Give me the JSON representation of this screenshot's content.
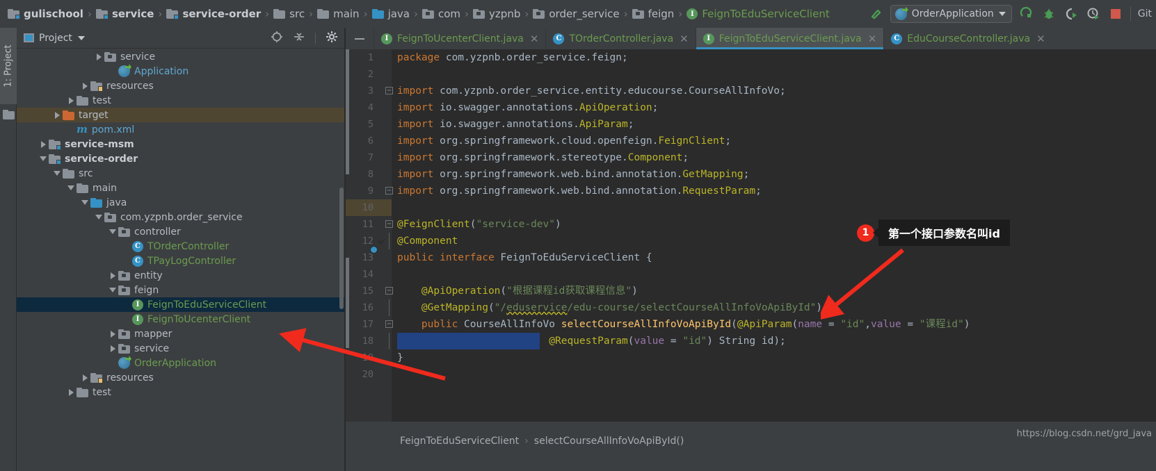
{
  "window": {
    "watermark": "https://blog.csdn.net/grd_java"
  },
  "breadcrumb": {
    "items": [
      {
        "label": "gulischool",
        "icon": "module-folder-icon",
        "style": "bold"
      },
      {
        "label": "service",
        "icon": "module-folder-icon",
        "style": "bold"
      },
      {
        "label": "service-order",
        "icon": "module-folder-icon",
        "style": "bold"
      },
      {
        "label": "src",
        "icon": "folder-icon",
        "style": "plain"
      },
      {
        "label": "main",
        "icon": "folder-icon",
        "style": "plain"
      },
      {
        "label": "java",
        "icon": "source-folder-icon",
        "style": "plain"
      },
      {
        "label": "com",
        "icon": "package-folder-icon",
        "style": "plain"
      },
      {
        "label": "yzpnb",
        "icon": "package-folder-icon",
        "style": "plain"
      },
      {
        "label": "order_service",
        "icon": "package-folder-icon",
        "style": "plain"
      },
      {
        "label": "feign",
        "icon": "package-folder-icon",
        "style": "plain"
      },
      {
        "label": "FeignToEduServiceClient",
        "icon": "interface-icon",
        "style": "interface"
      }
    ],
    "separator": "›"
  },
  "toolbar": {
    "run_config_name": "OrderApplication",
    "run_config_icon": "spring-boot-icon",
    "build_icon": "build-hammer-icon",
    "actions": [
      {
        "name": "run-icon",
        "glyph": "run"
      },
      {
        "name": "debug-icon",
        "glyph": "debug"
      },
      {
        "name": "run-with-coverage-icon",
        "glyph": "coverage"
      },
      {
        "name": "profile-icon",
        "glyph": "profile"
      },
      {
        "name": "stop-icon",
        "glyph": "stop"
      }
    ],
    "git_label": "Git"
  },
  "left_rail": {
    "tab_label": "1: Project"
  },
  "project_panel": {
    "title": "Project",
    "header_actions": [
      "locate-icon",
      "collapse-all-icon",
      "settings-gear-icon"
    ],
    "tree": [
      {
        "label": "service",
        "indent": 5,
        "twisty": "right",
        "icon": "package-folder-icon",
        "style": "plain"
      },
      {
        "label": "Application",
        "indent": 6,
        "twisty": "none",
        "icon": "spring-class-icon",
        "style": "blue"
      },
      {
        "label": "resources",
        "indent": 4,
        "twisty": "right",
        "icon": "resources-folder-icon",
        "style": "plain"
      },
      {
        "label": "test",
        "indent": 3,
        "twisty": "right",
        "icon": "folder-icon",
        "style": "plain"
      },
      {
        "label": "target",
        "indent": 2,
        "twisty": "right",
        "icon": "target-folder-icon",
        "style": "plain",
        "highlight": "target"
      },
      {
        "label": "pom.xml",
        "indent": 3,
        "twisty": "none",
        "icon": "maven-icon",
        "style": "blue"
      },
      {
        "label": "service-msm",
        "indent": 1,
        "twisty": "right",
        "icon": "module-folder-icon",
        "style": "bold"
      },
      {
        "label": "service-order",
        "indent": 1,
        "twisty": "down",
        "icon": "module-folder-icon",
        "style": "bold"
      },
      {
        "label": "src",
        "indent": 2,
        "twisty": "down",
        "icon": "folder-icon",
        "style": "plain"
      },
      {
        "label": "main",
        "indent": 3,
        "twisty": "down",
        "icon": "folder-icon",
        "style": "plain"
      },
      {
        "label": "java",
        "indent": 4,
        "twisty": "down",
        "icon": "source-folder-icon",
        "style": "plain"
      },
      {
        "label": "com.yzpnb.order_service",
        "indent": 5,
        "twisty": "down",
        "icon": "package-folder-icon",
        "style": "plain"
      },
      {
        "label": "controller",
        "indent": 6,
        "twisty": "down",
        "icon": "package-folder-icon",
        "style": "plain"
      },
      {
        "label": "TOrderController",
        "indent": 7,
        "twisty": "none",
        "icon": "class-icon",
        "style": "green"
      },
      {
        "label": "TPayLogController",
        "indent": 7,
        "twisty": "none",
        "icon": "class-icon",
        "style": "green"
      },
      {
        "label": "entity",
        "indent": 6,
        "twisty": "right",
        "icon": "package-folder-icon",
        "style": "plain"
      },
      {
        "label": "feign",
        "indent": 6,
        "twisty": "down",
        "icon": "package-folder-icon",
        "style": "plain"
      },
      {
        "label": "FeignToEduServiceClient",
        "indent": 7,
        "twisty": "none",
        "icon": "interface-icon",
        "style": "green",
        "selected": true
      },
      {
        "label": "FeignToUcenterClient",
        "indent": 7,
        "twisty": "none",
        "icon": "interface-icon",
        "style": "green"
      },
      {
        "label": "mapper",
        "indent": 6,
        "twisty": "right",
        "icon": "package-folder-icon",
        "style": "plain"
      },
      {
        "label": "service",
        "indent": 6,
        "twisty": "right",
        "icon": "package-folder-icon",
        "style": "plain"
      },
      {
        "label": "OrderApplication",
        "indent": 6,
        "twisty": "none",
        "icon": "spring-class-icon",
        "style": "green"
      },
      {
        "label": "resources",
        "indent": 4,
        "twisty": "right",
        "icon": "resources-folder-icon",
        "style": "plain"
      },
      {
        "label": "test",
        "indent": 3,
        "twisty": "right",
        "icon": "folder-icon",
        "style": "plain"
      }
    ]
  },
  "editor_tabs": [
    {
      "label": "FeignToUcenterClient.java",
      "icon": "interface-icon",
      "active": false
    },
    {
      "label": "TOrderController.java",
      "icon": "class-icon",
      "active": false
    },
    {
      "label": "FeignToEduServiceClient.java",
      "icon": "interface-icon",
      "active": true
    },
    {
      "label": "EduCourseController.java",
      "icon": "class-icon",
      "active": false
    }
  ],
  "editor": {
    "lines": [
      {
        "n": "1",
        "tokens": [
          {
            "t": "package ",
            "c": "kw"
          },
          {
            "t": "com.yzpnb.order_service.feign;",
            "c": "plain2"
          }
        ]
      },
      {
        "n": "2",
        "tokens": []
      },
      {
        "n": "3",
        "fold": "minus",
        "tokens": [
          {
            "t": "import ",
            "c": "kw"
          },
          {
            "t": "com.yzpnb.order_service.entity.educourse.",
            "c": "plain2"
          },
          {
            "t": "CourseAllInfoVo",
            "c": "plain2"
          },
          {
            "t": ";",
            "c": "plain2"
          }
        ]
      },
      {
        "n": "4",
        "tokens": [
          {
            "t": "import ",
            "c": "kw"
          },
          {
            "t": "io.swagger.annotations.",
            "c": "plain2"
          },
          {
            "t": "ApiOperation",
            "c": "ann"
          },
          {
            "t": ";",
            "c": "plain2"
          }
        ]
      },
      {
        "n": "5",
        "tokens": [
          {
            "t": "import ",
            "c": "kw"
          },
          {
            "t": "io.swagger.annotations.",
            "c": "plain2"
          },
          {
            "t": "ApiParam",
            "c": "ann"
          },
          {
            "t": ";",
            "c": "plain2"
          }
        ]
      },
      {
        "n": "6",
        "tokens": [
          {
            "t": "import ",
            "c": "kw"
          },
          {
            "t": "org.springframework.cloud.openfeign.",
            "c": "plain2"
          },
          {
            "t": "FeignClient",
            "c": "ann"
          },
          {
            "t": ";",
            "c": "plain2"
          }
        ]
      },
      {
        "n": "7",
        "tokens": [
          {
            "t": "import ",
            "c": "kw"
          },
          {
            "t": "org.springframework.stereotype.",
            "c": "plain2"
          },
          {
            "t": "Component",
            "c": "ann"
          },
          {
            "t": ";",
            "c": "plain2"
          }
        ]
      },
      {
        "n": "8",
        "tokens": [
          {
            "t": "import ",
            "c": "kw"
          },
          {
            "t": "org.springframework.web.bind.annotation.",
            "c": "plain2"
          },
          {
            "t": "GetMapping",
            "c": "ann"
          },
          {
            "t": ";",
            "c": "plain2"
          }
        ]
      },
      {
        "n": "9",
        "fold": "minus2",
        "tokens": [
          {
            "t": "import ",
            "c": "kw"
          },
          {
            "t": "org.springframework.web.bind.annotation.",
            "c": "plain2"
          },
          {
            "t": "RequestParam",
            "c": "ann"
          },
          {
            "t": ";",
            "c": "plain2"
          }
        ]
      },
      {
        "n": "10",
        "tokens": []
      },
      {
        "n": "11",
        "fold": "minus",
        "tokens": [
          {
            "t": "@FeignClient",
            "c": "ann"
          },
          {
            "t": "(",
            "c": "plain2"
          },
          {
            "t": "\"service-dev\"",
            "c": "str"
          },
          {
            "t": ")",
            "c": "plain2"
          }
        ]
      },
      {
        "n": "12",
        "gicon": "spring-bean-leaf-icon",
        "fold": "bar",
        "tokens": [
          {
            "t": "@Component",
            "c": "ann"
          }
        ]
      },
      {
        "n": "13",
        "gicon": "spring-bean-icon",
        "tokens": [
          {
            "t": "public interface ",
            "c": "kw"
          },
          {
            "t": "FeignToEduServiceClient ",
            "c": "plain2"
          },
          {
            "t": "{",
            "c": "plain2"
          }
        ]
      },
      {
        "n": "14",
        "tokens": []
      },
      {
        "n": "15",
        "fold": "minus",
        "tokens": [
          {
            "t": "    @ApiOperation",
            "c": "ann"
          },
          {
            "t": "(",
            "c": "plain2"
          },
          {
            "t": "\"根据课程id获取课程信息\"",
            "c": "str"
          },
          {
            "t": ")",
            "c": "plain2"
          }
        ]
      },
      {
        "n": "16",
        "fold": "bar",
        "tokens": [
          {
            "t": "    @GetMapping",
            "c": "ann"
          },
          {
            "t": "(",
            "c": "plain2"
          },
          {
            "t": "\"/",
            "c": "str"
          },
          {
            "t": "eduservice",
            "c": "str squig"
          },
          {
            "t": "/edu-course/selectCourseAllInfoVoApiById\"",
            "c": "str"
          },
          {
            "t": ")",
            "c": "plain2"
          }
        ]
      },
      {
        "n": "17",
        "fold": "minus",
        "tokens": [
          {
            "t": "    public ",
            "c": "kw"
          },
          {
            "t": "CourseAllInfoVo ",
            "c": "plain2"
          },
          {
            "t": "selectCourseAllInfoVoApiById",
            "c": "fn"
          },
          {
            "t": "(",
            "c": "plain2"
          },
          {
            "t": "@ApiParam",
            "c": "ann"
          },
          {
            "t": "(",
            "c": "plain2"
          },
          {
            "t": "name",
            "c": "par"
          },
          {
            "t": " = ",
            "c": "plain2"
          },
          {
            "t": "\"id\"",
            "c": "str"
          },
          {
            "t": ",",
            "c": "plain2"
          },
          {
            "t": "value",
            "c": "par"
          },
          {
            "t": " = ",
            "c": "plain2"
          },
          {
            "t": "\"课程id\"",
            "c": "str"
          },
          {
            "t": ")",
            "c": "plain2"
          }
        ]
      },
      {
        "n": "18",
        "fold": "bar",
        "selection": true,
        "tokens": [
          {
            "t": "                         ",
            "c": "plain2"
          },
          {
            "t": "@RequestParam",
            "c": "ann"
          },
          {
            "t": "(",
            "c": "plain2"
          },
          {
            "t": "value",
            "c": "par"
          },
          {
            "t": " = ",
            "c": "plain2"
          },
          {
            "t": "\"id\"",
            "c": "str"
          },
          {
            "t": ") ",
            "c": "plain2"
          },
          {
            "t": "String ",
            "c": "plain2"
          },
          {
            "t": "id",
            "c": "plain2"
          },
          {
            "t": ");",
            "c": "plain2"
          }
        ]
      },
      {
        "n": "19",
        "tokens": [
          {
            "t": "}",
            "c": "plain2"
          }
        ]
      },
      {
        "n": "20",
        "tokens": []
      }
    ]
  },
  "callout": {
    "number": "1",
    "text": "第一个接口参数名叫id",
    "color": "#f02a1d"
  },
  "status_bar": {
    "crumbs": [
      "FeignToEduServiceClient",
      "selectCourseAllInfoVoApiById()"
    ],
    "separator": "›"
  }
}
